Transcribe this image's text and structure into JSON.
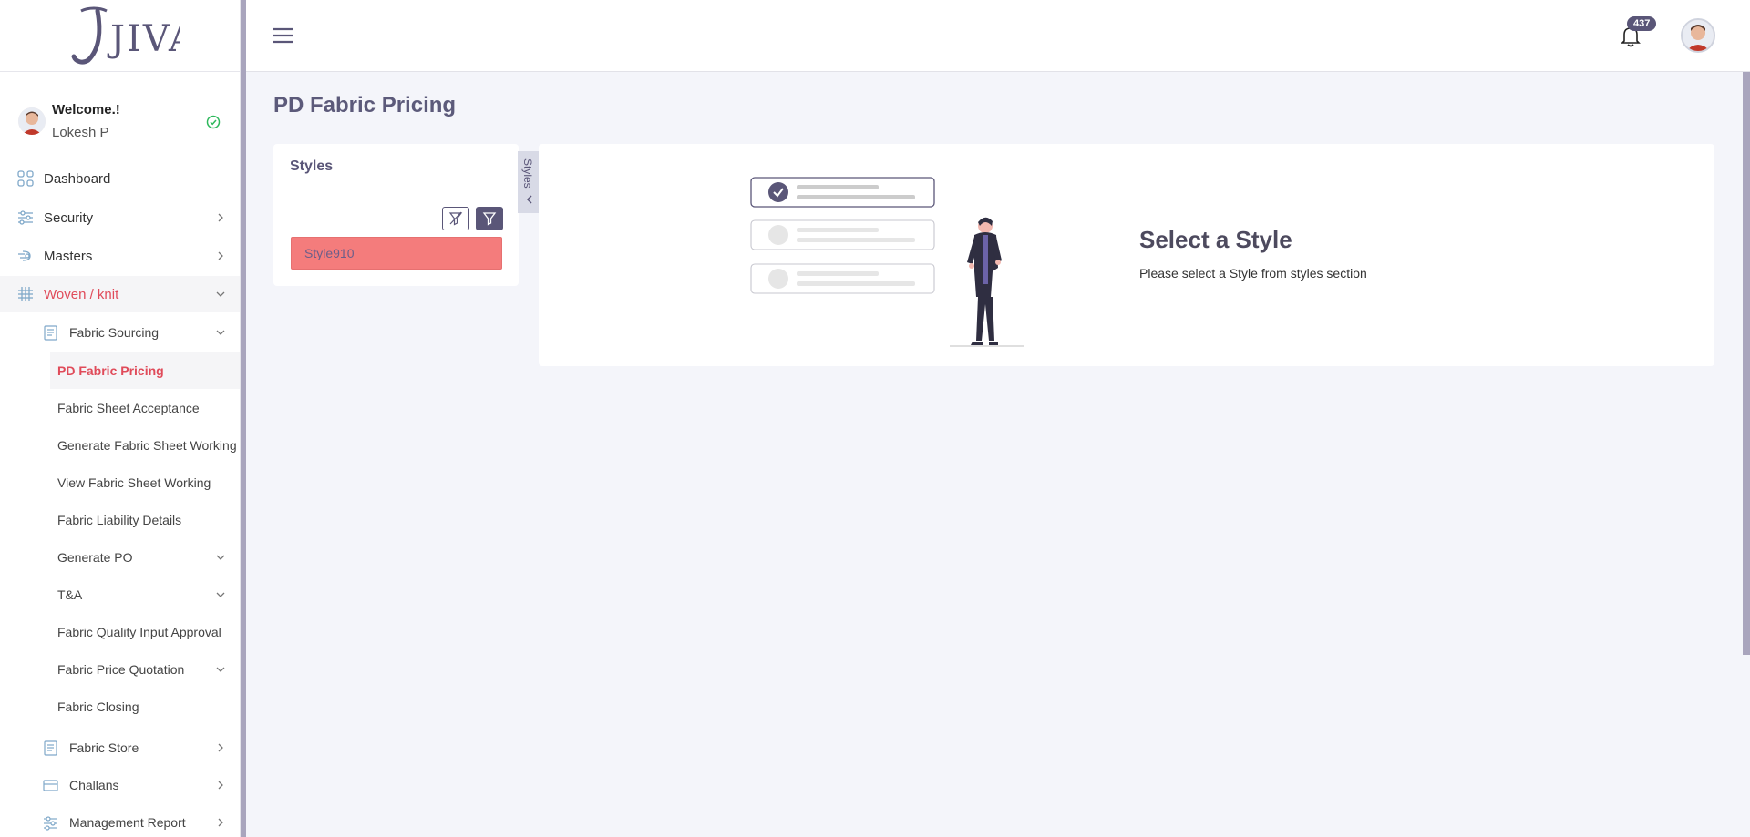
{
  "app": {
    "logo": "JIVA"
  },
  "user": {
    "welcome": "Welcome.!",
    "name": "Lokesh P",
    "status": "online"
  },
  "notifications": {
    "count": "437"
  },
  "sidebar": {
    "items": [
      {
        "label": "Dashboard",
        "icon": "grid-icon"
      },
      {
        "label": "Security",
        "icon": "sliders-icon"
      },
      {
        "label": "Masters",
        "icon": "speed-icon"
      },
      {
        "label": "Woven / knit",
        "icon": "hash-icon"
      }
    ],
    "woven_children": [
      {
        "label": "Fabric Sourcing",
        "icon": "document-icon"
      },
      {
        "label": "Fabric Store",
        "icon": "document-icon"
      },
      {
        "label": "Challans",
        "icon": "card-icon"
      },
      {
        "label": "Management Report",
        "icon": "sliders-icon"
      }
    ],
    "fabric_sourcing_items": [
      {
        "label": "PD Fabric Pricing"
      },
      {
        "label": "Fabric Sheet Acceptance"
      },
      {
        "label": "Generate Fabric Sheet Working"
      },
      {
        "label": "View Fabric Sheet Working"
      },
      {
        "label": "Fabric Liability Details"
      },
      {
        "label": "Generate PO"
      },
      {
        "label": "T&A"
      },
      {
        "label": "Fabric Quality Input Approval"
      },
      {
        "label": "Fabric Price Quotation"
      },
      {
        "label": "Fabric Closing"
      }
    ]
  },
  "page": {
    "title": "PD Fabric Pricing"
  },
  "styles_panel": {
    "header": "Styles",
    "toggle_label": "Styles",
    "items": [
      {
        "label": "Style910"
      }
    ]
  },
  "empty_state": {
    "title": "Select a Style",
    "subtitle": "Please select a Style from styles section"
  },
  "colors": {
    "brand": "#5a5678",
    "active": "#e04b5a",
    "selected_style": "#f47c7c",
    "background": "#f4f5fa"
  }
}
